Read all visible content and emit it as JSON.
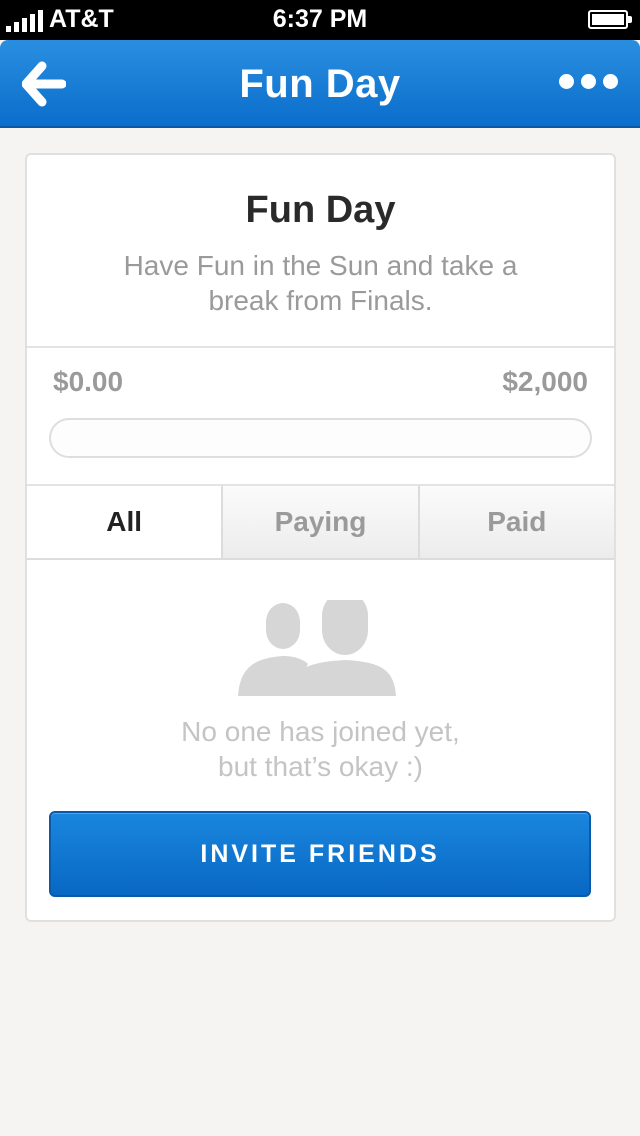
{
  "status_bar": {
    "carrier": "AT&T",
    "time": "6:37 PM",
    "signal_icon": "signal-bars-icon",
    "battery_icon": "battery-icon"
  },
  "nav": {
    "title": "Fun Day",
    "back_icon": "back-arrow-icon",
    "more_icon": "more-dots-icon",
    "accent_color": "#0a6ecc"
  },
  "event": {
    "title": "Fun Day",
    "description": "Have Fun in the Sun and take a break from Finals."
  },
  "progress": {
    "raised": "$0.00",
    "goal": "$2,000",
    "fraction": 0
  },
  "tabs": [
    {
      "label": "All",
      "active": true
    },
    {
      "label": "Paying",
      "active": false
    },
    {
      "label": "Paid",
      "active": false
    }
  ],
  "empty_state": {
    "icon": "people-icon",
    "line1": "No one has joined yet,",
    "line2": "but that’s okay :)"
  },
  "invite_button": {
    "label": "INVITE FRIENDS",
    "color": "#0a6ecc"
  }
}
